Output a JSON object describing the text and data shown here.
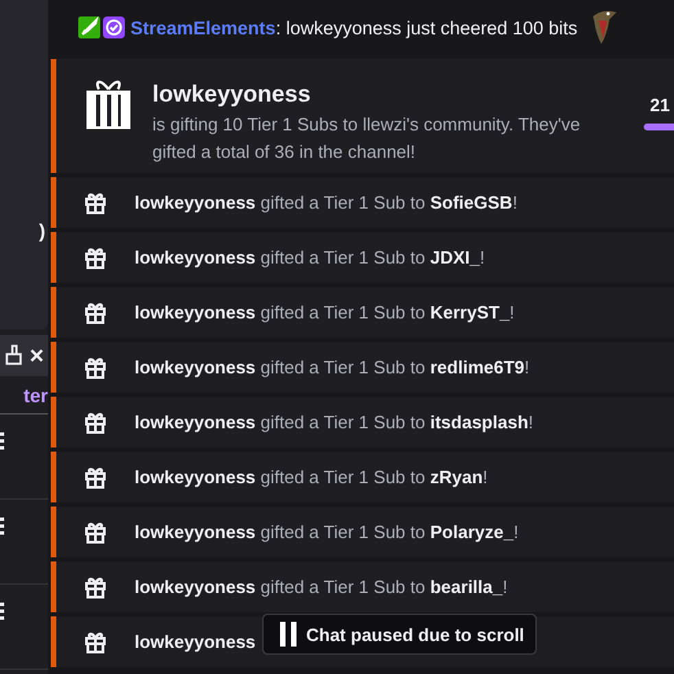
{
  "sidebar": {
    "fragments": [
      {
        "kind": "text",
        "text": ")"
      },
      {
        "kind": "close",
        "text": "×"
      },
      {
        "kind": "link",
        "text": "ter"
      }
    ],
    "menus": [
      {
        "kind": "more"
      },
      {
        "kind": "more"
      },
      {
        "kind": "more"
      }
    ]
  },
  "chat_message": {
    "badges": [
      {
        "kind": "moderator"
      },
      {
        "kind": "verified"
      }
    ],
    "user": "StreamElements",
    "text": ": lowkeyyoness just cheered 100 bits"
  },
  "gift_card": {
    "user": "lowkeyyoness",
    "text": "is gifting 10 Tier 1 Subs to llewzi's community. They've gifted a total of 36 in the channel!",
    "count": "21"
  },
  "gifts": [
    {
      "gifter": "lowkeyyoness",
      "text": "gifted a Tier 1 Sub to",
      "recipient": "SofieGSB",
      "end": "!"
    },
    {
      "gifter": "lowkeyyoness",
      "text": "gifted a Tier 1 Sub to",
      "recipient": "JDXI_",
      "end": "!"
    },
    {
      "gifter": "lowkeyyoness",
      "text": "gifted a Tier 1 Sub to",
      "recipient": "KerryST_",
      "end": "!"
    },
    {
      "gifter": "lowkeyyoness",
      "text": "gifted a Tier 1 Sub to",
      "recipient": "redlime6T9",
      "end": "!"
    },
    {
      "gifter": "lowkeyyoness",
      "text": "gifted a Tier 1 Sub to",
      "recipient": "itsdasplash",
      "end": "!"
    },
    {
      "gifter": "lowkeyyoness",
      "text": "gifted a Tier 1 Sub to",
      "recipient": "zRyan",
      "end": "!"
    },
    {
      "gifter": "lowkeyyoness",
      "text": "gifted a Tier 1 Sub to",
      "recipient": "Polaryze_",
      "end": "!"
    },
    {
      "gifter": "lowkeyyoness",
      "text": "gifted a Tier 1 Sub to",
      "recipient": "bearilla_",
      "end": "!"
    },
    {
      "gifter": "lowkeyyoness"
    }
  ],
  "paused_notice": "Chat paused due to scroll"
}
